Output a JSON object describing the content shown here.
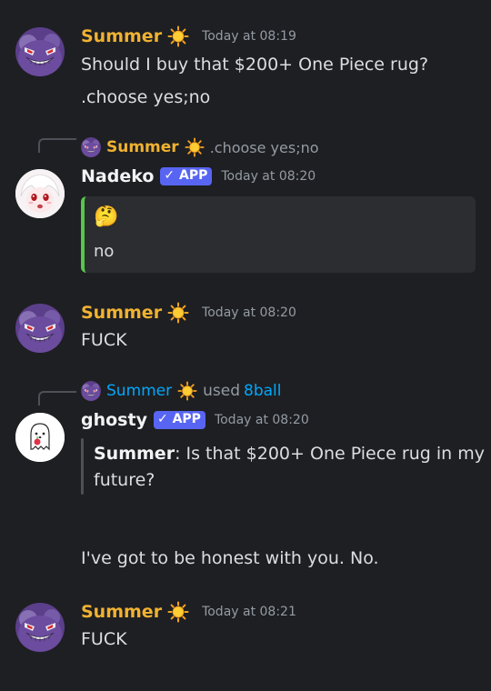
{
  "messages": [
    {
      "author": "Summer",
      "timestamp": "Today at 08:19",
      "lines": [
        "Should I buy that $200+ One Piece rug?",
        ".choose yes;no"
      ]
    },
    {
      "reply": {
        "author": "Summer",
        "text": ".choose yes;no"
      },
      "author": "Nadeko",
      "badge": "APP",
      "timestamp": "Today at 08:20",
      "embed": {
        "emoji": "🤔",
        "text": "no",
        "accent": "#57c84a"
      }
    },
    {
      "author": "Summer",
      "timestamp": "Today at 08:20",
      "lines": [
        "FUCK"
      ]
    },
    {
      "reply": {
        "author": "Summer",
        "used": "used",
        "command": "8ball"
      },
      "author": "ghosty",
      "badge": "APP",
      "timestamp": "Today at 08:20",
      "quote": {
        "bold": "Summer",
        "line1": ": Is that $200+ One Piece rug in my",
        "line2": "future?"
      },
      "answer": "I've got to be honest with you. No."
    },
    {
      "author": "Summer",
      "timestamp": "Today at 08:21",
      "lines": [
        "FUCK"
      ]
    }
  ],
  "icons": {
    "sun": "sun-emoji-icon",
    "verified": "checkmark-icon"
  },
  "colors": {
    "background": "#1e1f22",
    "summer_name": "#f0b232",
    "mention_blue": "#00a8fc",
    "app_badge": "#5865f2",
    "embed_accent": "#57c84a"
  }
}
